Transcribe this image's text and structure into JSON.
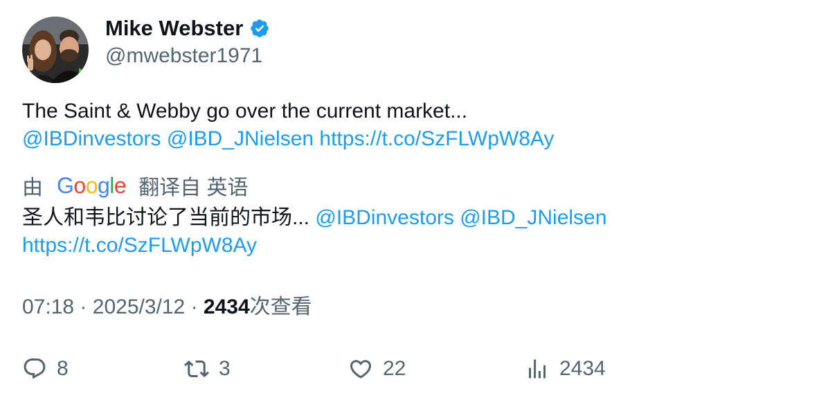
{
  "author": {
    "display_name": "Mike Webster",
    "handle": "@mwebster1971",
    "verified": true,
    "verified_color": "#1d9bf0",
    "avatar_icon": "profile-photo"
  },
  "tweet": {
    "text": "The Saint & Webby go over the current market...",
    "mentions": [
      "@IBDinvestors",
      "@IBD_JNielsen"
    ],
    "link": "https://t.co/SzFLWpW8Ay"
  },
  "translation": {
    "prefix": "由",
    "provider": "Google",
    "suffix": "翻译自 英语",
    "text": "圣人和韦比讨论了当前的市场...",
    "mentions": [
      "@IBDinvestors",
      "@IBD_JNielsen"
    ],
    "link": "https://t.co/SzFLWpW8Ay"
  },
  "meta": {
    "time": "07:18",
    "separator": "·",
    "date": "2025/3/12",
    "views_count": "2434",
    "views_label": "次查看"
  },
  "actions": {
    "replies": "8",
    "retweets": "3",
    "likes": "22",
    "views": "2434"
  },
  "colors": {
    "link": "#1d9bf0",
    "secondary_text": "#536471",
    "primary_text": "#0f1419"
  }
}
